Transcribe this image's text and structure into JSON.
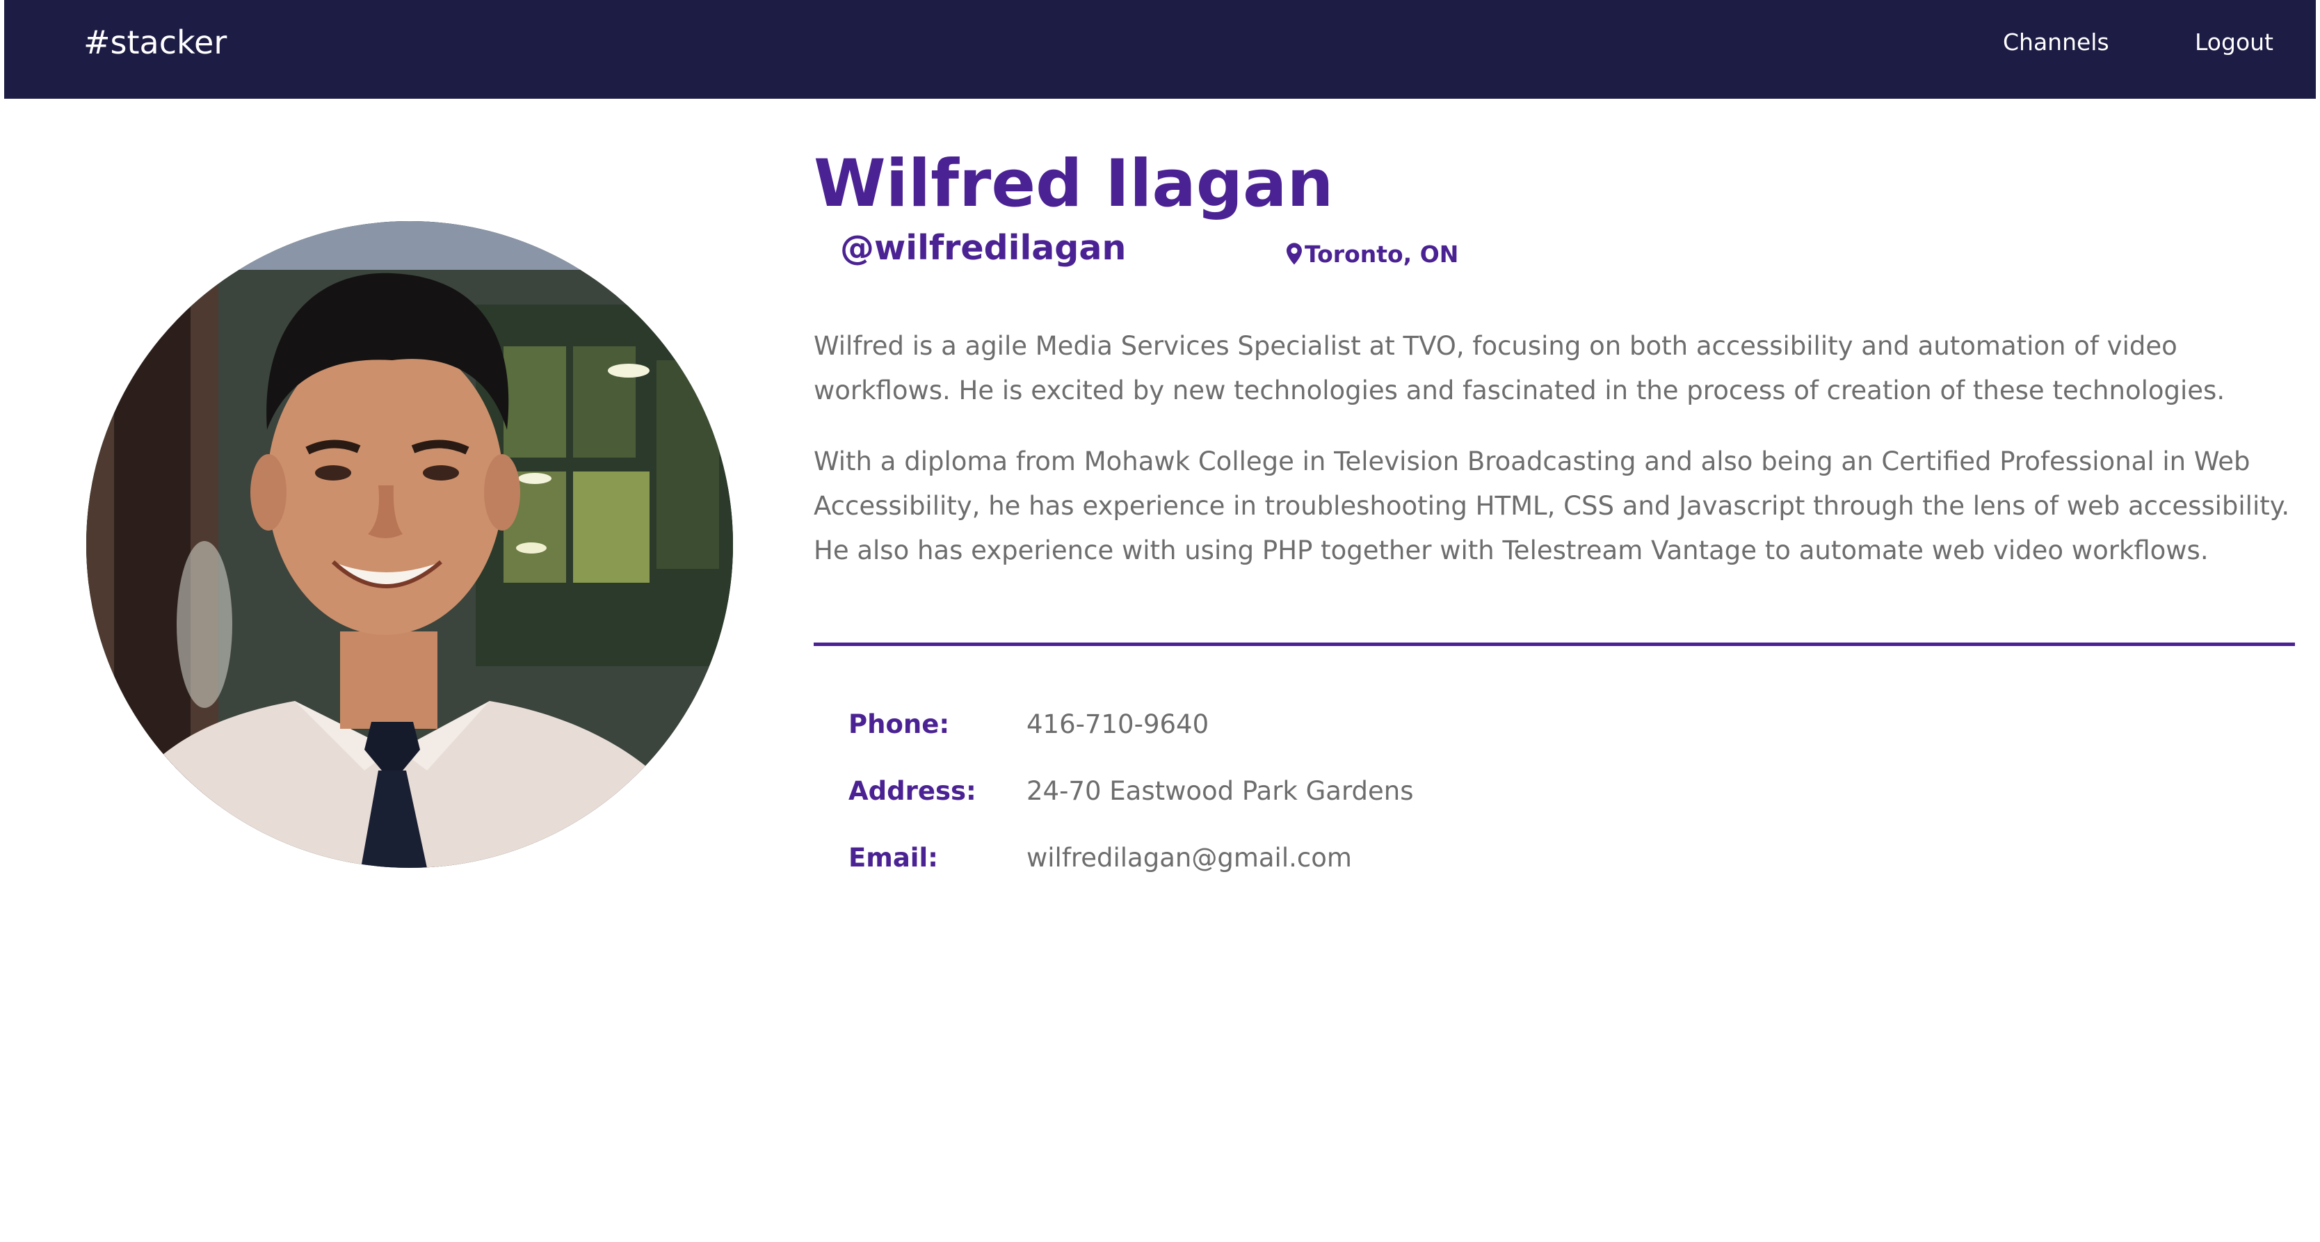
{
  "nav": {
    "brand": "#stacker",
    "links": [
      {
        "label": "Channels"
      },
      {
        "label": "Logout"
      }
    ]
  },
  "profile": {
    "name": "Wilfred Ilagan",
    "handle": "@wilfredilagan",
    "location": "Toronto, ON",
    "bio": [
      "Wilfred is a agile Media Services Specialist at TVO, focusing on both accessibility and automation of video workflows. He is excited by new technologies and fascinated in the process of creation of these technologies.",
      "With a diploma from Mohawk College in Television Broadcasting and also being an Certified Professional in Web Accessibility, he has experience in troubleshooting HTML, CSS and Javascript through the lens of web accessibility. He also has experience with using PHP together with Telestream Vantage to automate web video workflows."
    ],
    "contact": {
      "phone_label": "Phone:",
      "phone": "416-710-9640",
      "address_label": "Address:",
      "address": "24-70 Eastwood Park Gardens",
      "email_label": "Email:",
      "email": "wilfredilagan@gmail.com"
    }
  },
  "icons": {
    "location": "map-marker-icon"
  },
  "colors": {
    "navbar": "#1d1c45",
    "accent": "#4b2293",
    "body_text": "#6d6d6d",
    "background": "#ffffff"
  }
}
